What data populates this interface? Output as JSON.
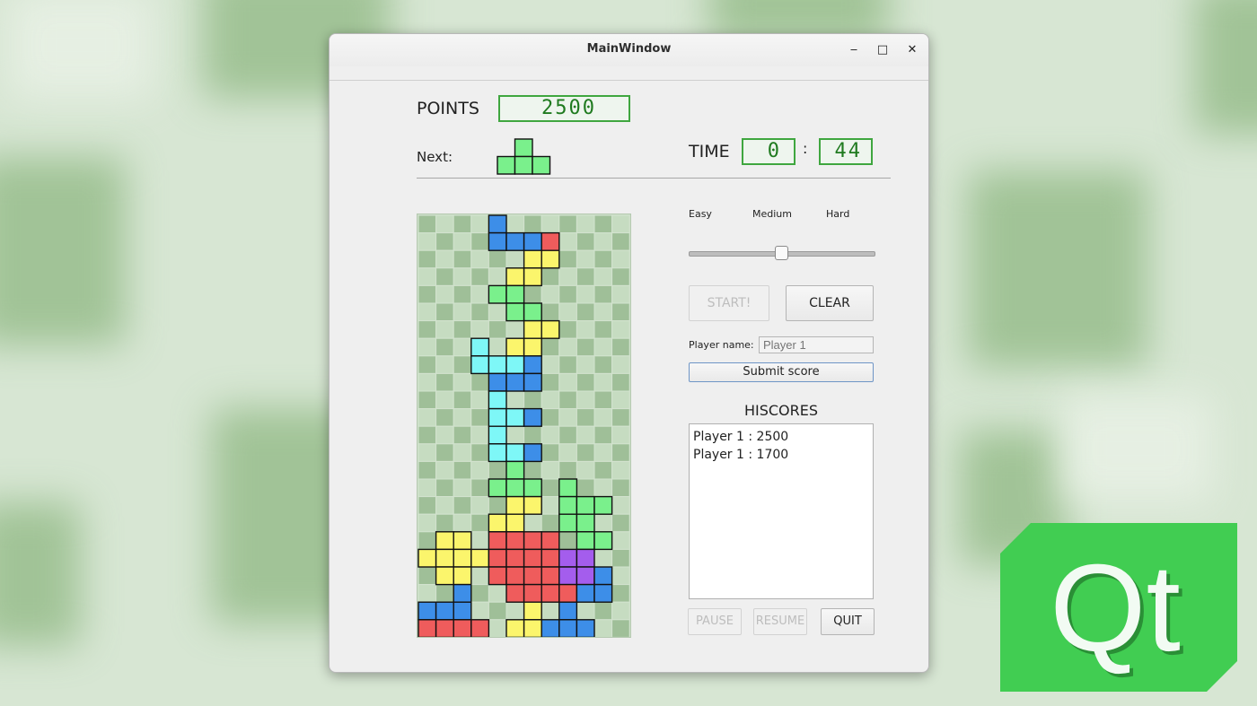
{
  "window": {
    "title": "MainWindow",
    "minimize": "‒",
    "maximize": "□",
    "close": "✕"
  },
  "game": {
    "points_label": "POINTS",
    "points_value": "2500",
    "next_label": "Next:",
    "time_label": "TIME",
    "time_minutes": "0",
    "time_separator": ":",
    "time_seconds": "44"
  },
  "difficulty": {
    "levels": [
      "Easy",
      "Medium",
      "Hard"
    ],
    "value": 0.5
  },
  "controls": {
    "start": "START!",
    "clear": "CLEAR",
    "player_label": "Player name:",
    "player_placeholder": "Player 1",
    "submit": "Submit score",
    "pause": "PAUSE",
    "resume": "RESUME",
    "quit": "QUIT"
  },
  "hiscores": {
    "title": "HISCORES",
    "entries": [
      "Player 1 : 2500",
      "Player 1 : 1700"
    ]
  },
  "logo": {
    "text": "Qt"
  },
  "colors": {
    "B": "#3d8ee8",
    "R": "#ef5c5c",
    "Y": "#fbf56c",
    "G": "#7af08c",
    "C": "#7ef7f7",
    "P": "#a45ded",
    "empty_dark": "#9fbf98",
    "empty_light": "#c6dcc1",
    "lcd": "#3fa63f",
    "qt_green": "#41cd52"
  },
  "next_piece": [
    "..G..",
    ".GGG."
  ],
  "board": [
    "....B.......",
    "....BBBR....",
    "......YY....",
    ".....YY.....",
    "....GG......",
    ".....GG.....",
    "......YY....",
    "...C.YY.....",
    "...CCCB.....",
    "....BBB.....",
    "....C.......",
    "....CCB.....",
    "....C.......",
    "....CCB.....",
    ".....G......",
    "....GGG.G...",
    ".....YY.GGG.",
    "....YY..GG..",
    ".YY.RRRR.GG.",
    "YYYYRRRRPP..",
    ".YY.RRRRPPB.",
    "..B..RRRRBB.",
    "BBB...Y.B...",
    "RRRR.YYBBB.."
  ]
}
